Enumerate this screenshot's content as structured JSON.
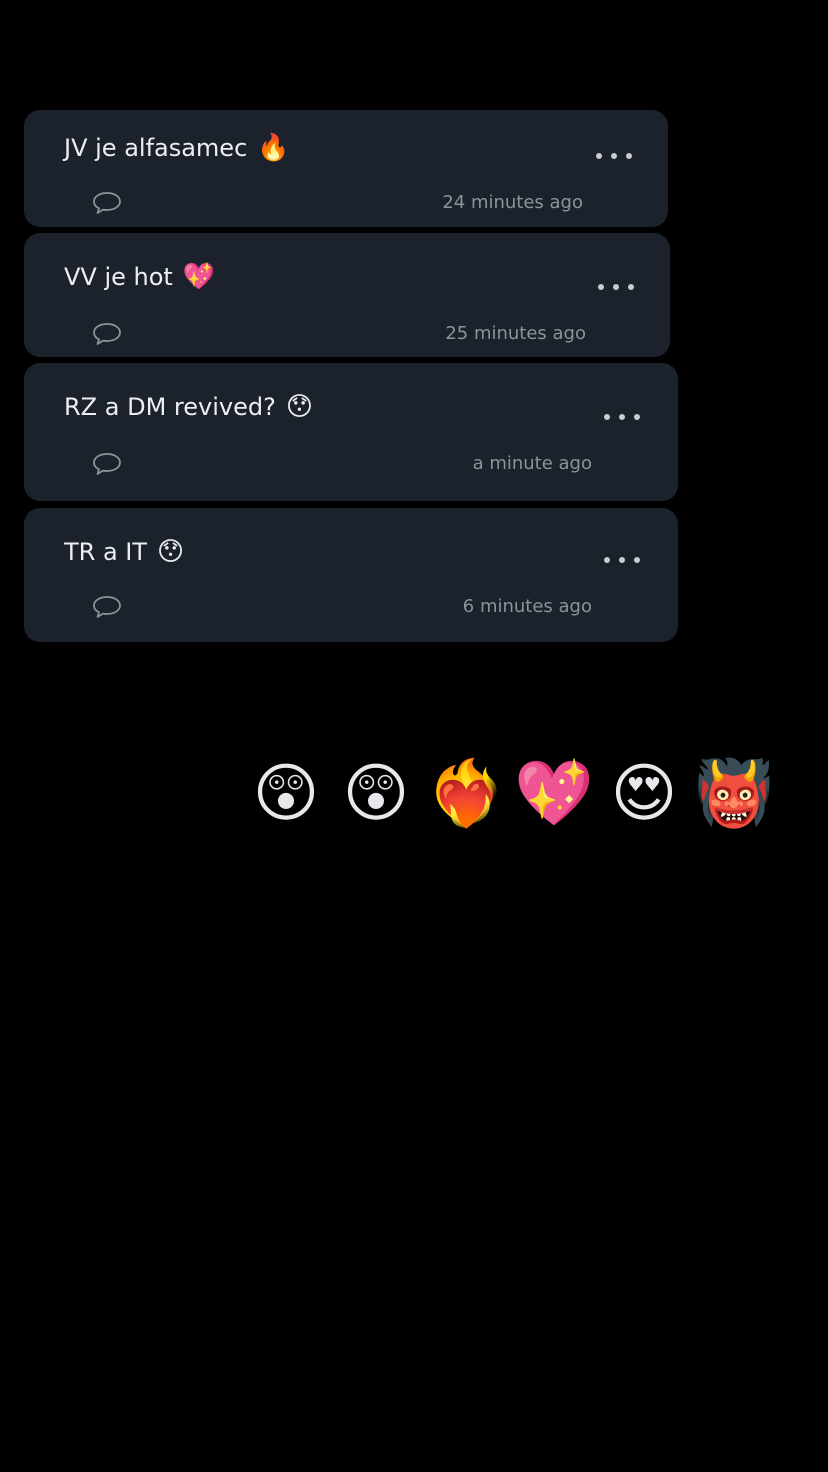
{
  "posts": [
    {
      "text": "JV je alfasamec",
      "emoji": "🔥",
      "time": "24 minutes ago"
    },
    {
      "text": "VV je hot",
      "emoji": "💖",
      "time": "25 minutes ago"
    },
    {
      "text": "RZ a DM revived?",
      "emoji": "😯",
      "time": "a minute ago"
    },
    {
      "text": "TR a IT",
      "emoji": "😯",
      "time": "6 minutes ago"
    }
  ],
  "reactions": [
    {
      "emoji": "😲",
      "icon": "astonished-face-icon"
    },
    {
      "emoji": "😲",
      "icon": "astonished-face-icon"
    },
    {
      "emoji": "❤️‍🔥",
      "icon": "heart-on-fire-icon"
    },
    {
      "emoji": "💖",
      "icon": "sparkling-heart-icon"
    },
    {
      "emoji": "😍",
      "icon": "heart-eyes-face-icon"
    },
    {
      "emoji": "👹",
      "icon": "ogre-icon"
    }
  ],
  "colors": {
    "background": "#000000",
    "card": "#1c222c",
    "text": "#eceef2",
    "muted": "#8d929b"
  }
}
